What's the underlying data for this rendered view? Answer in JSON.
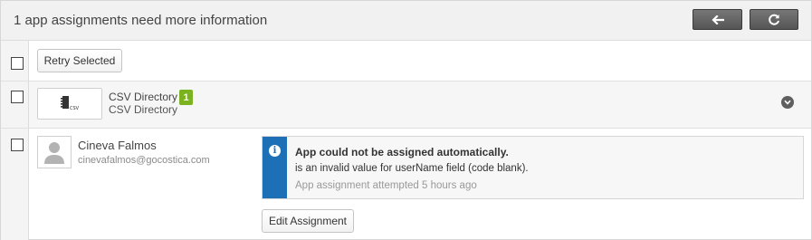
{
  "header": {
    "title": "1 app assignments need more information",
    "back_icon": "arrow-left-icon",
    "refresh_icon": "refresh-icon"
  },
  "toolbar": {
    "retry_label": "Retry Selected"
  },
  "app": {
    "name": "CSV Directory",
    "subtitle": "CSV Directory",
    "count": "1",
    "logo_text": "CSV",
    "badge_color": "#7bb21f"
  },
  "user": {
    "name": "Cineva Falmos",
    "email": "cinevafalmos@gocostica.com"
  },
  "alert": {
    "icon": "info-icon",
    "title": "App could not be assigned automatically.",
    "message": "is an invalid value for userName field (code blank).",
    "time": "App assignment attempted 5 hours ago",
    "accent": "#1d6fb6"
  },
  "actions": {
    "edit_label": "Edit Assignment"
  }
}
